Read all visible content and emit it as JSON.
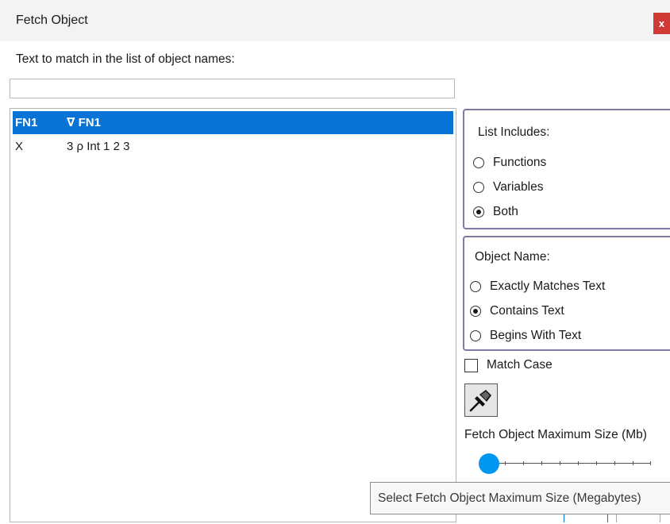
{
  "window": {
    "title": "Fetch Object",
    "close_label": "x"
  },
  "search": {
    "prompt": "Text to match in the list of object names:",
    "value": ""
  },
  "objects": [
    {
      "name": "FN1",
      "value": "∇ FN1",
      "selected": true
    },
    {
      "name": "X",
      "value": "3 ρ Int 1 2 3",
      "selected": false
    }
  ],
  "list_includes": {
    "label": "List Includes:",
    "options": [
      "Functions",
      "Variables",
      "Both"
    ],
    "selected": "Both"
  },
  "object_name": {
    "label": "Object Name:",
    "options": [
      "Exactly Matches Text",
      "Contains Text",
      "Begins With Text"
    ],
    "selected": "Contains Text"
  },
  "match_case": {
    "label": "Match Case",
    "checked": false
  },
  "pin_button": {
    "icon": "pushpin-icon"
  },
  "max_size": {
    "label": "Fetch Object Maximum Size (Mb)",
    "slider_position": 0,
    "tooltip": "Select Fetch Object Maximum Size (Megabytes)"
  },
  "colors": {
    "selection": "#0a74d6",
    "slider_thumb": "#0096f2",
    "close_button": "#cf3a35",
    "group_border": "#7b7ba6"
  }
}
